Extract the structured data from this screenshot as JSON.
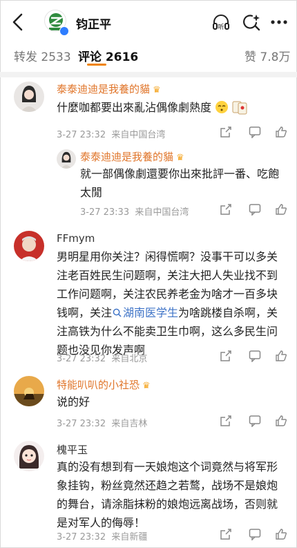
{
  "header": {
    "title": "钧正平",
    "icons": [
      "back-chevron-icon",
      "listen-icon",
      "ai-search-icon",
      "more-icon"
    ],
    "listen_label": "听"
  },
  "tabs": {
    "repost": "转发 2533",
    "comments": "评论 2616",
    "likes": "赞 7.8万",
    "accent_color": "#f08300"
  },
  "comments": [
    {
      "name": "泰泰迪迪是我養的貓",
      "text": "什麼咖都要出來亂沾偶像劇熱度",
      "time": "3-27 23:32",
      "source": "来自中国台湾",
      "reply": {
        "name": "泰泰迪迪是我養的貓",
        "text": "就一部偶像劇還要你出來批評一番、吃飽太閒",
        "time": "3-27 23:33",
        "source": "来自中国台湾"
      }
    },
    {
      "name": "FFmym",
      "text_before": "男明星用你关注？闲得慌啊？没事干可以多关注老百姓民生问题啊，关注大把人失业找不到工作问题啊，关注农民养老金为啥才一百多块钱啊，关注",
      "link": "湖南医学生",
      "text_after": "为啥跳楼自杀啊，关注高铁为什么不能卖卫生巾啊，这么多民生问题也没见你发声啊",
      "time": "3-27 23:32",
      "source": "来自北京"
    },
    {
      "name": "特能叭叭的小社恐",
      "text": "说的好",
      "time": "3-27 23:32",
      "source": "来自吉林"
    },
    {
      "name": "槐平玉",
      "text": "真的没有想到有一天娘炮这个词竟然与将军形象挂钩，粉丝竟然还趋之若鹜，战场不是娘炮的舞台，请涂脂抹粉的娘炮远离战场，否则就是对军人的侮辱！",
      "time": "3-27 23:32",
      "source": "来自新疆"
    }
  ]
}
